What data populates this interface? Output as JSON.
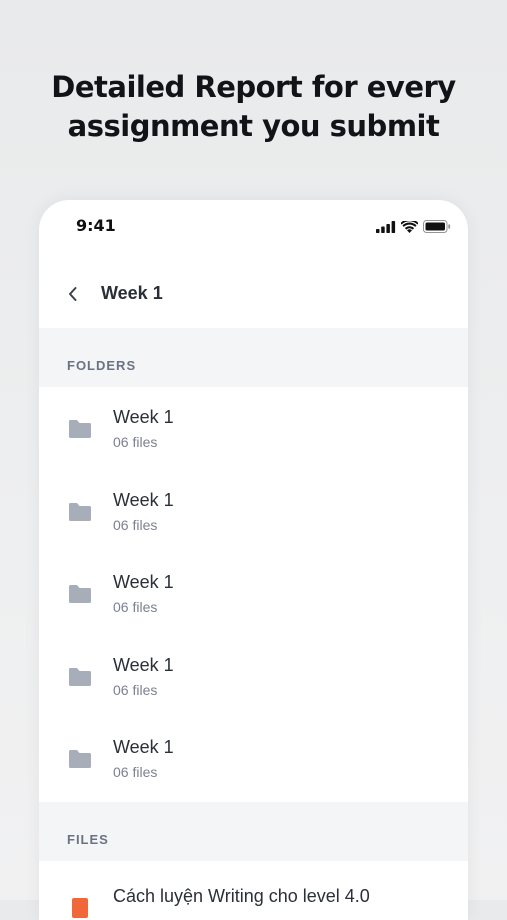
{
  "headline": {
    "line1": "Detailed Report for every",
    "line2": "assignment you submit"
  },
  "status_bar": {
    "time": "9:41"
  },
  "nav": {
    "title": "Week 1"
  },
  "sections": {
    "folders_label": "FOLDERS",
    "files_label": "FILES"
  },
  "folders": [
    {
      "name": "Week 1",
      "count": "06 files"
    },
    {
      "name": "Week 1",
      "count": "06 files"
    },
    {
      "name": "Week 1",
      "count": "06 files"
    },
    {
      "name": "Week 1",
      "count": "06 files"
    },
    {
      "name": "Week 1",
      "count": "06 files"
    }
  ],
  "files": [
    {
      "name": "Cách luyện Writing cho level 4.0"
    }
  ],
  "colors": {
    "folder_icon": "#a8aeb9",
    "file_icon": "#f0683a",
    "section_bg": "#f4f5f7"
  }
}
